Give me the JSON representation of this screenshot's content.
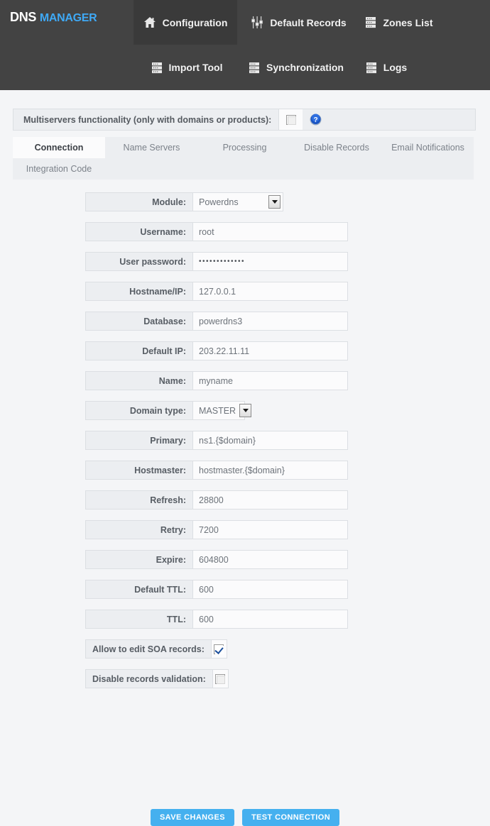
{
  "brand": {
    "primary": "DNS",
    "secondary": "MANAGER",
    "accent_color": "#3fa9f5"
  },
  "nav": {
    "row1": [
      {
        "label": "Configuration",
        "icon": "home-icon",
        "active": true
      },
      {
        "label": "Default Records",
        "icon": "sliders-icon",
        "active": false
      },
      {
        "label": "Zones List",
        "icon": "list-icon",
        "active": false
      }
    ],
    "row2": [
      {
        "label": "Import Tool",
        "icon": "list-icon",
        "active": false
      },
      {
        "label": "Synchronization",
        "icon": "list-icon",
        "active": false
      },
      {
        "label": "Logs",
        "icon": "list-icon",
        "active": false
      }
    ]
  },
  "multiservers": {
    "label": "Multiservers functionality (only with domains or products):",
    "checked": false,
    "help_icon": "help-icon"
  },
  "tabs": [
    {
      "label": "Connection",
      "active": true
    },
    {
      "label": "Name Servers",
      "active": false
    },
    {
      "label": "Processing",
      "active": false
    },
    {
      "label": "Disable Records",
      "active": false
    },
    {
      "label": "Email Notifications",
      "active": false
    },
    {
      "label": "Integration Code",
      "active": false
    }
  ],
  "form": {
    "fields": [
      {
        "label": "Module:",
        "value": "Powerdns",
        "type": "select"
      },
      {
        "label": "Username:",
        "value": "root",
        "type": "text"
      },
      {
        "label": "User password:",
        "value": "•••••••••••••",
        "type": "password"
      },
      {
        "label": "Hostname/IP:",
        "value": "127.0.0.1",
        "type": "text"
      },
      {
        "label": "Database:",
        "value": "powerdns3",
        "type": "text"
      },
      {
        "label": "Default IP:",
        "value": "203.22.11.11",
        "type": "text"
      },
      {
        "label": "Name:",
        "value": "myname",
        "type": "text"
      },
      {
        "label": "Domain type:",
        "value": "MASTER",
        "type": "select"
      },
      {
        "label": "Primary:",
        "value": "ns1.{$domain}",
        "type": "text"
      },
      {
        "label": "Hostmaster:",
        "value": "hostmaster.{$domain}",
        "type": "text"
      },
      {
        "label": "Refresh:",
        "value": "28800",
        "type": "text"
      },
      {
        "label": "Retry:",
        "value": "7200",
        "type": "text"
      },
      {
        "label": "Expire:",
        "value": "604800",
        "type": "text"
      },
      {
        "label": "Default TTL:",
        "value": "600",
        "type": "text"
      },
      {
        "label": "TTL:",
        "value": "600",
        "type": "text"
      }
    ],
    "checkboxes": [
      {
        "label": "Allow to edit SOA records:",
        "checked": true
      },
      {
        "label": "Disable records validation:",
        "checked": false
      }
    ]
  },
  "buttons": [
    {
      "label": "SAVE CHANGES",
      "name": "save-changes-button"
    },
    {
      "label": "TEST CONNECTION",
      "name": "test-connection-button"
    }
  ]
}
